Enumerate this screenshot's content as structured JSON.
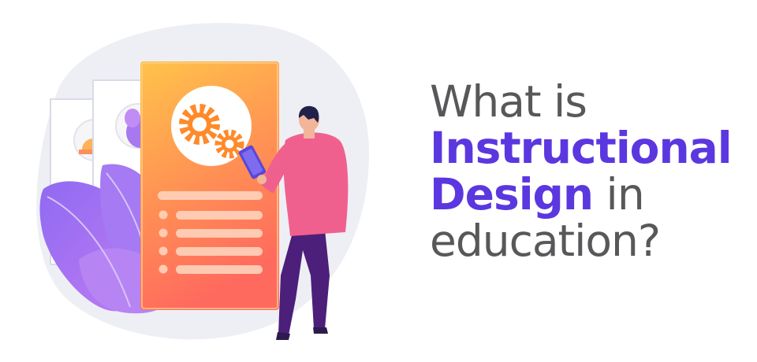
{
  "headline": {
    "line1": "What is",
    "line2_highlight": "Instructional",
    "line3_highlight": "Design",
    "line3_rest": " in",
    "line4": "education?"
  },
  "colors": {
    "text": "#58585a",
    "highlight": "#5b37e0",
    "panel_top": "#ffc34a",
    "panel_bottom": "#ff6a5e",
    "leaves": "#9d6cf0",
    "shirt": "#f0608e",
    "pants": "#4c1f7a"
  },
  "illustration": {
    "icons": [
      "gears-icon",
      "tablet-icon",
      "list-icon",
      "leaves-icon",
      "person-icon"
    ]
  }
}
